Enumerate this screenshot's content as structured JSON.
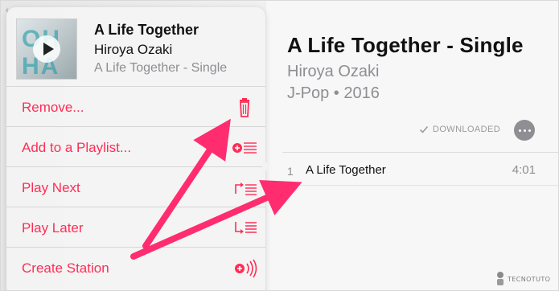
{
  "colors": {
    "accent": "#ff2d55",
    "secondary_text": "#8e8e93",
    "arrow": "#ff2d6f"
  },
  "popover": {
    "song": {
      "title": "A Life Together",
      "artist": "Hiroya Ozaki",
      "album": "A Life Together - Single",
      "art_text": "OH HA"
    },
    "items": [
      {
        "label": "Remove...",
        "icon": "trash-icon"
      },
      {
        "label": "Add to a Playlist...",
        "icon": "add-to-playlist-icon"
      },
      {
        "label": "Play Next",
        "icon": "play-next-icon"
      },
      {
        "label": "Play Later",
        "icon": "play-later-icon"
      },
      {
        "label": "Create Station",
        "icon": "create-station-icon"
      }
    ]
  },
  "album": {
    "title": "A Life Together - Single",
    "artist": "Hiroya Ozaki",
    "meta": "J-Pop • 2016",
    "downloaded_label": "DOWNLOADED",
    "tracks": [
      {
        "number": "1",
        "title": "A Life Together",
        "duration": "4:01"
      }
    ]
  },
  "watermark": "TECNOTUTO"
}
